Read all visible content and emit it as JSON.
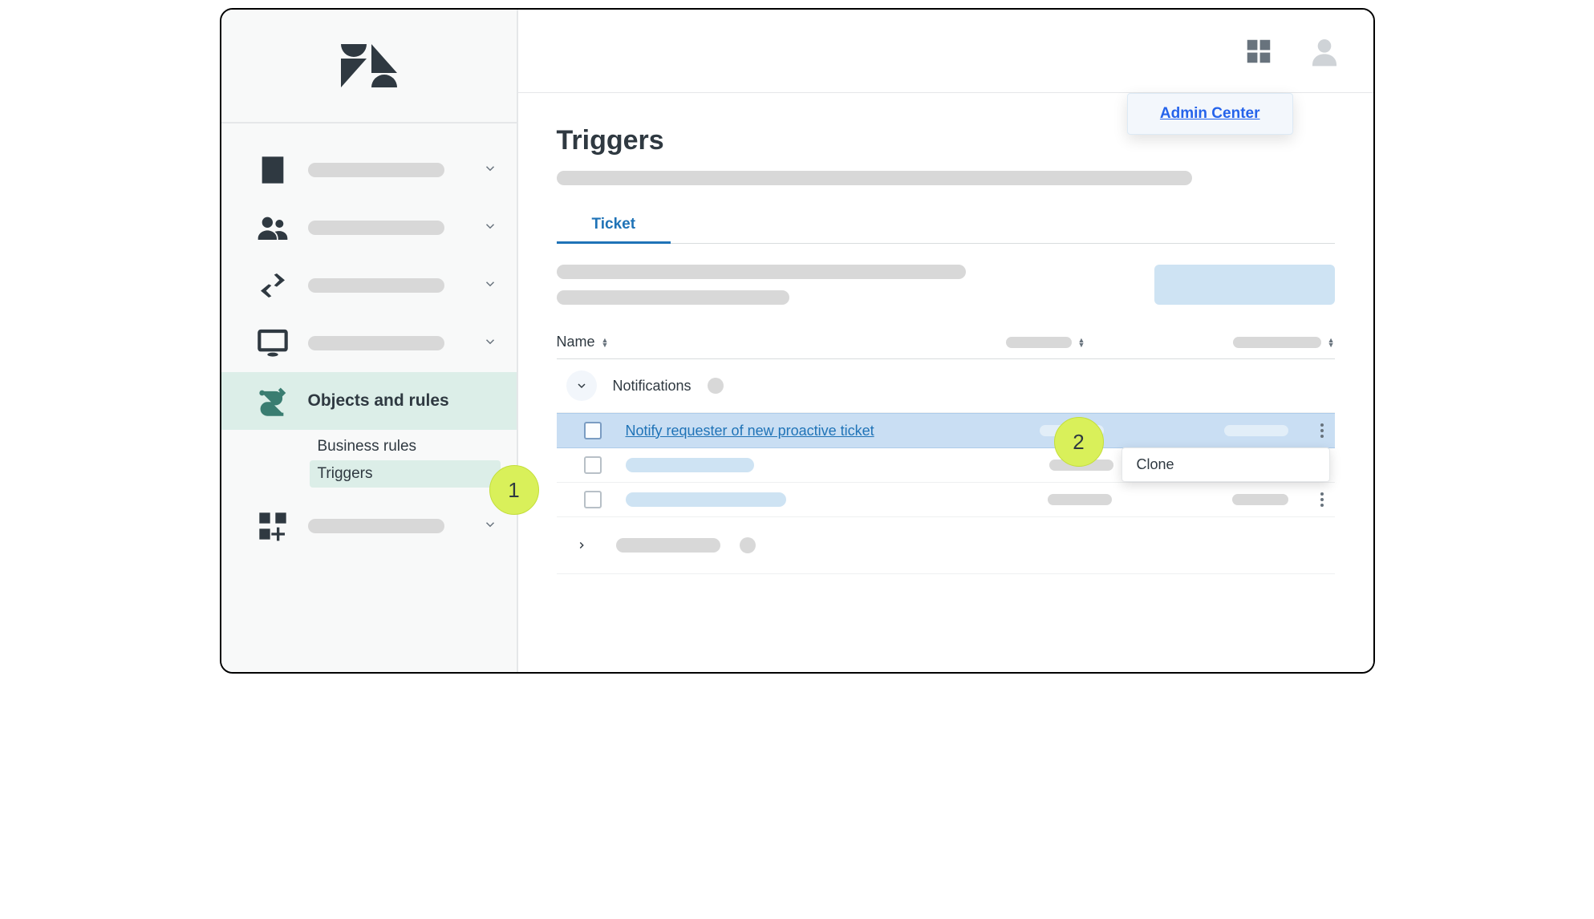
{
  "header": {
    "admin_center_label": "Admin Center"
  },
  "sidebar": {
    "items": [
      {
        "has_label": false
      },
      {
        "has_label": false
      },
      {
        "has_label": false
      },
      {
        "has_label": false
      },
      {
        "label": "Objects and rules",
        "active": true
      },
      {
        "has_label": false
      }
    ],
    "subnav_parent": "Business rules",
    "subnav_active": "Triggers"
  },
  "page": {
    "title": "Triggers",
    "tabs": [
      {
        "label": "Ticket",
        "active": true
      }
    ],
    "table": {
      "columns": {
        "name": "Name"
      },
      "groups": [
        {
          "label": "Notifications",
          "expanded": true,
          "rows": [
            {
              "name": "Notify requester of new proactive ticket",
              "highlight": true
            },
            {
              "placeholder": true
            },
            {
              "placeholder": true
            }
          ]
        },
        {
          "expanded": false,
          "placeholder": true
        }
      ]
    },
    "menu": {
      "clone": "Clone"
    }
  },
  "annotations": {
    "one": "1",
    "two": "2"
  }
}
